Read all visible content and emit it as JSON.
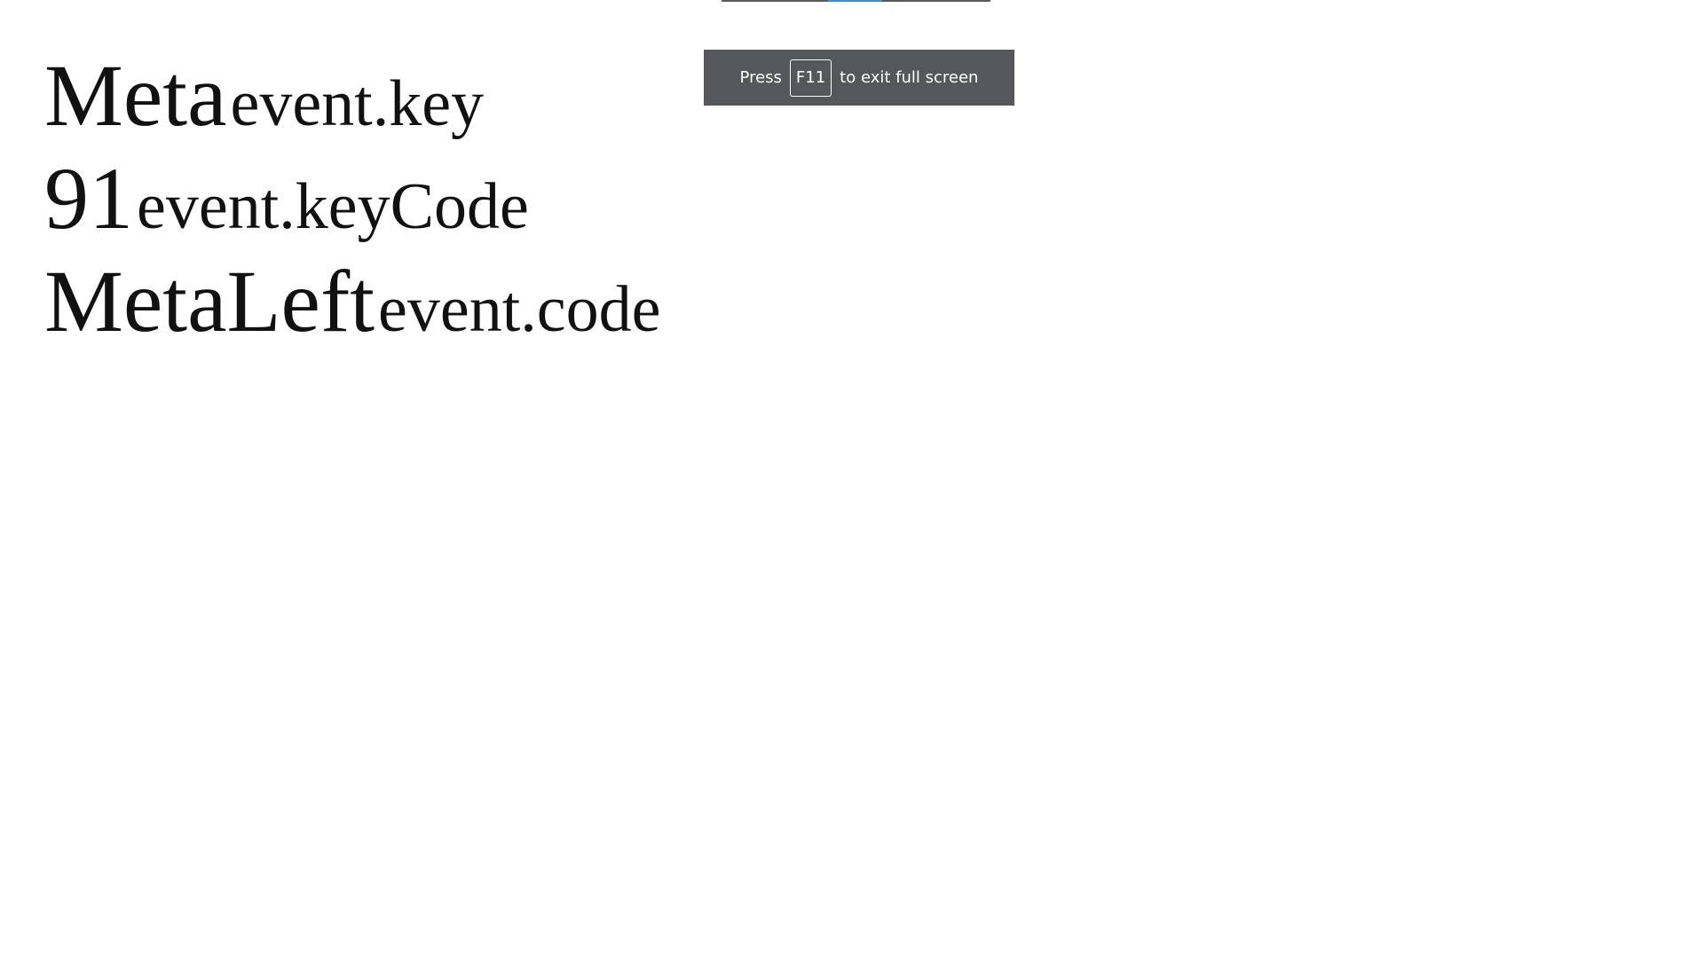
{
  "key_event": {
    "key": {
      "value": "Meta",
      "label": "event.key"
    },
    "keyCode": {
      "value": "91",
      "label": "event.keyCode"
    },
    "code": {
      "value": "MetaLeft",
      "label": "event.code"
    }
  },
  "fullscreen_toast": {
    "prefix": "Press",
    "key": "F11",
    "suffix": "to exit full screen"
  },
  "colors": {
    "toast_background": "#55575a",
    "indicator_accent": "#3a8fd8",
    "text": "#111111"
  }
}
